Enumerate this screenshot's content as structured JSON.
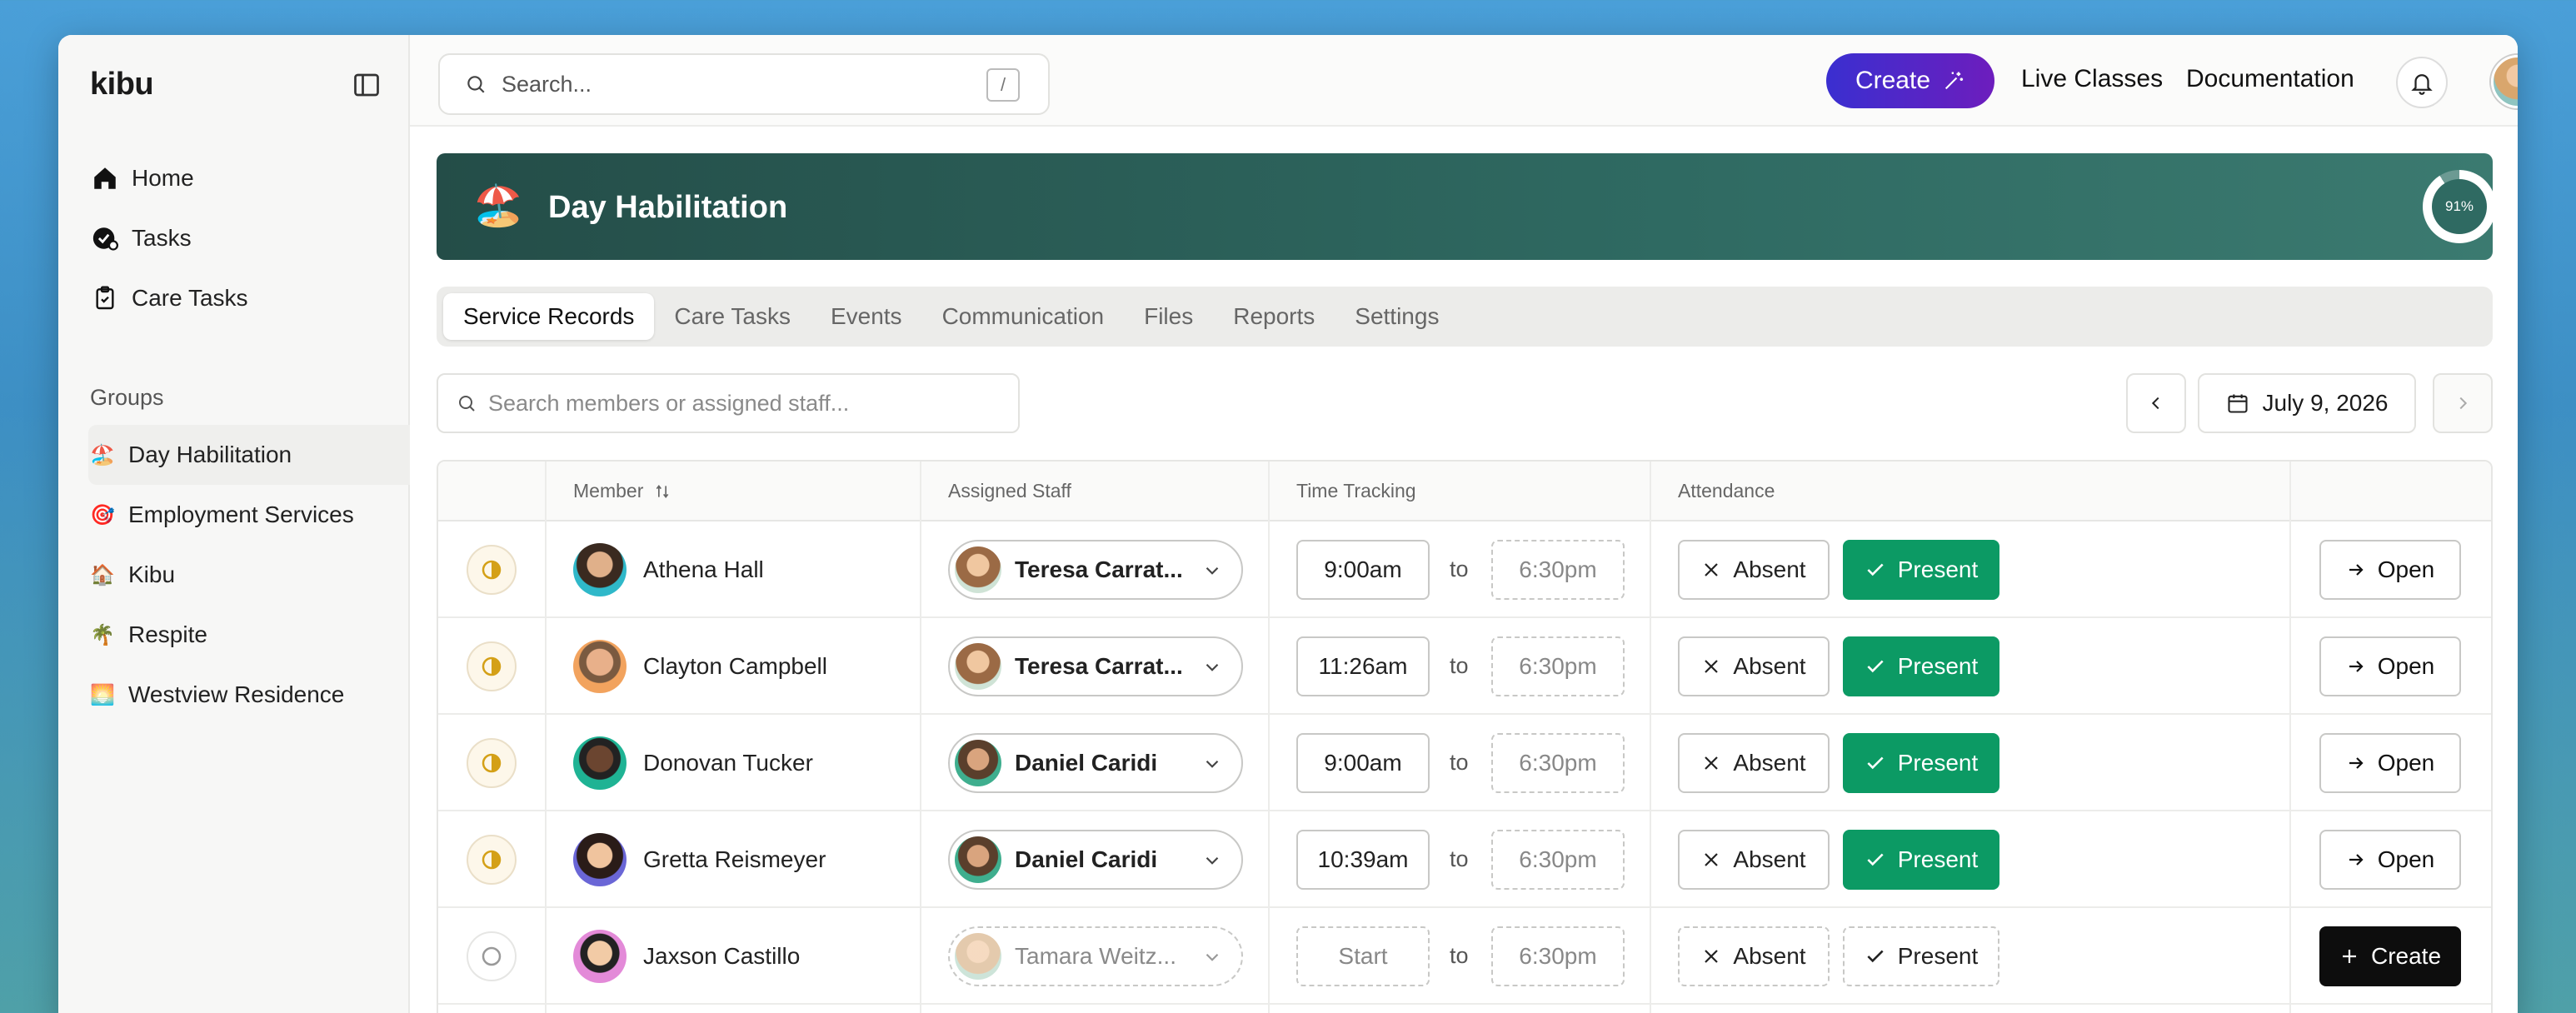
{
  "app": {
    "logo": "kibu"
  },
  "sidebar": {
    "nav": [
      {
        "label": "Home",
        "icon": "home-icon"
      },
      {
        "label": "Tasks",
        "icon": "tasks-icon"
      },
      {
        "label": "Care Tasks",
        "icon": "clipboard-icon"
      }
    ],
    "groups_title": "Groups",
    "groups": [
      {
        "label": "Day Habilitation",
        "emoji": "🏖️",
        "active": true
      },
      {
        "label": "Employment Services",
        "emoji": "🎯"
      },
      {
        "label": "Kibu",
        "emoji": "🏠"
      },
      {
        "label": "Respite",
        "emoji": "🌴"
      },
      {
        "label": "Westview Residence",
        "emoji": "🌅"
      }
    ]
  },
  "header": {
    "search_placeholder": "Search...",
    "search_shortcut": "/",
    "create_label": "Create",
    "live_classes": "Live Classes",
    "documentation": "Documentation"
  },
  "banner": {
    "emoji": "🏖️",
    "title": "Day Habilitation",
    "progress_label": "91%",
    "progress_value": 0.91
  },
  "tabs": [
    "Service Records",
    "Care Tasks",
    "Events",
    "Communication",
    "Files",
    "Reports",
    "Settings"
  ],
  "member_search_placeholder": "Search members or assigned staff...",
  "date": {
    "label": "July 9, 2026"
  },
  "table": {
    "headers": {
      "member": "Member",
      "staff": "Assigned Staff",
      "time": "Time Tracking",
      "attendance": "Attendance"
    },
    "to_label": "to",
    "absent_label": "Absent",
    "present_label": "Present",
    "open_label": "Open",
    "create_label": "Create",
    "rows": [
      {
        "member": "Athena Hall",
        "staff": "Teresa Carrat...",
        "start": "9:00am",
        "end": "6:30pm",
        "present": true,
        "status": "half",
        "avatar_bg": "#2fb8c9",
        "staff_bg": "#c98d5e"
      },
      {
        "member": "Clayton Campbell",
        "staff": "Teresa Carrat...",
        "start": "11:26am",
        "end": "6:30pm",
        "present": true,
        "status": "half",
        "avatar_bg": "#f2a35e",
        "staff_bg": "#c98d5e"
      },
      {
        "member": "Donovan Tucker",
        "staff": "Daniel Caridi",
        "start": "9:00am",
        "end": "6:30pm",
        "present": true,
        "status": "half",
        "avatar_bg": "#1fb394",
        "staff_bg": "#8a6a4e"
      },
      {
        "member": "Gretta Reismeyer",
        "staff": "Daniel Caridi",
        "start": "10:39am",
        "end": "6:30pm",
        "present": true,
        "status": "half",
        "avatar_bg": "#6a66d6",
        "staff_bg": "#8a6a4e"
      },
      {
        "member": "Jaxson Castillo",
        "staff": "Tamara Weitz...",
        "start": "Start",
        "end": "6:30pm",
        "present": false,
        "status": "empty",
        "avatar_bg": "#e38ad8",
        "staff_bg": "#d9b48a"
      }
    ]
  }
}
